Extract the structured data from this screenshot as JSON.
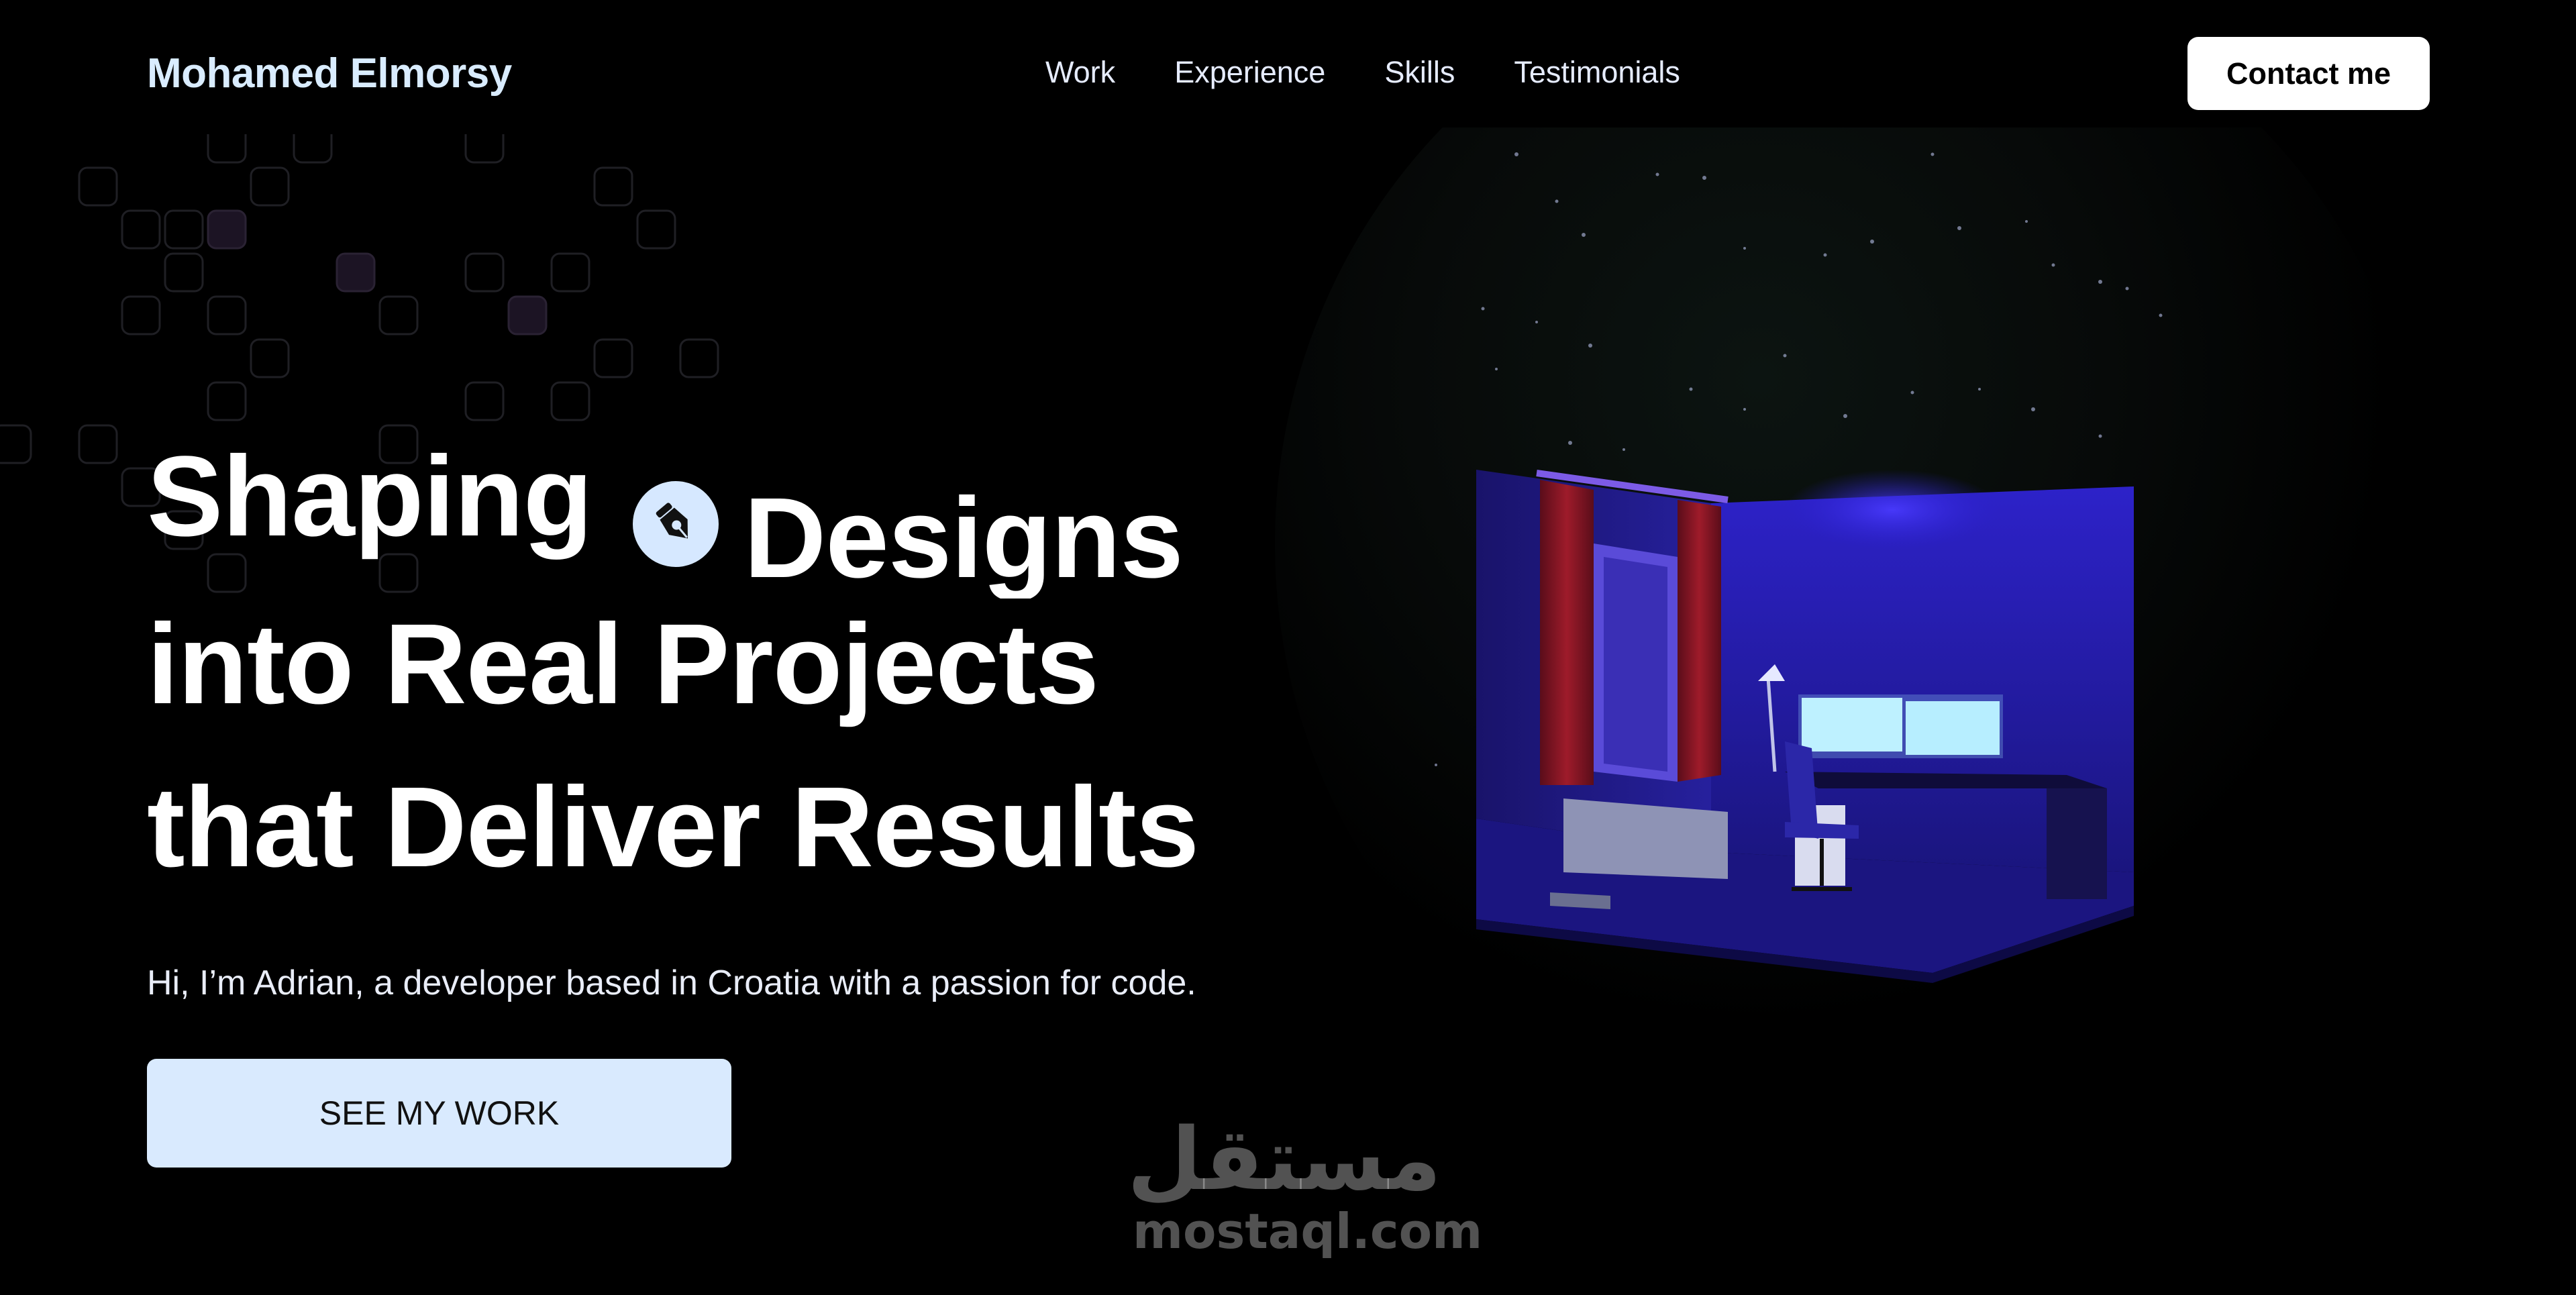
{
  "nav": {
    "logo": "Mohamed Elmorsy",
    "links": [
      "Work",
      "Experience",
      "Skills",
      "Testimonials"
    ],
    "contact_label": "Contact me"
  },
  "hero": {
    "line1_word": "Shaping",
    "sliding_word": "Designs",
    "line2": "into Real Projects",
    "line3": "that Deliver Results",
    "subtitle": "Hi, I’m Adrian, a developer based in Croatia with a passion for code.",
    "cta_label": "SEE MY WORK",
    "badge_icon": "pen-nib-icon"
  },
  "watermark": {
    "arabic": "مستقل",
    "latin": "mostaql.com"
  },
  "colors": {
    "background": "#000000",
    "accent_light": "#d9eafe",
    "logo": "#d9ecff",
    "scene_blue": "#2a1fd0"
  }
}
